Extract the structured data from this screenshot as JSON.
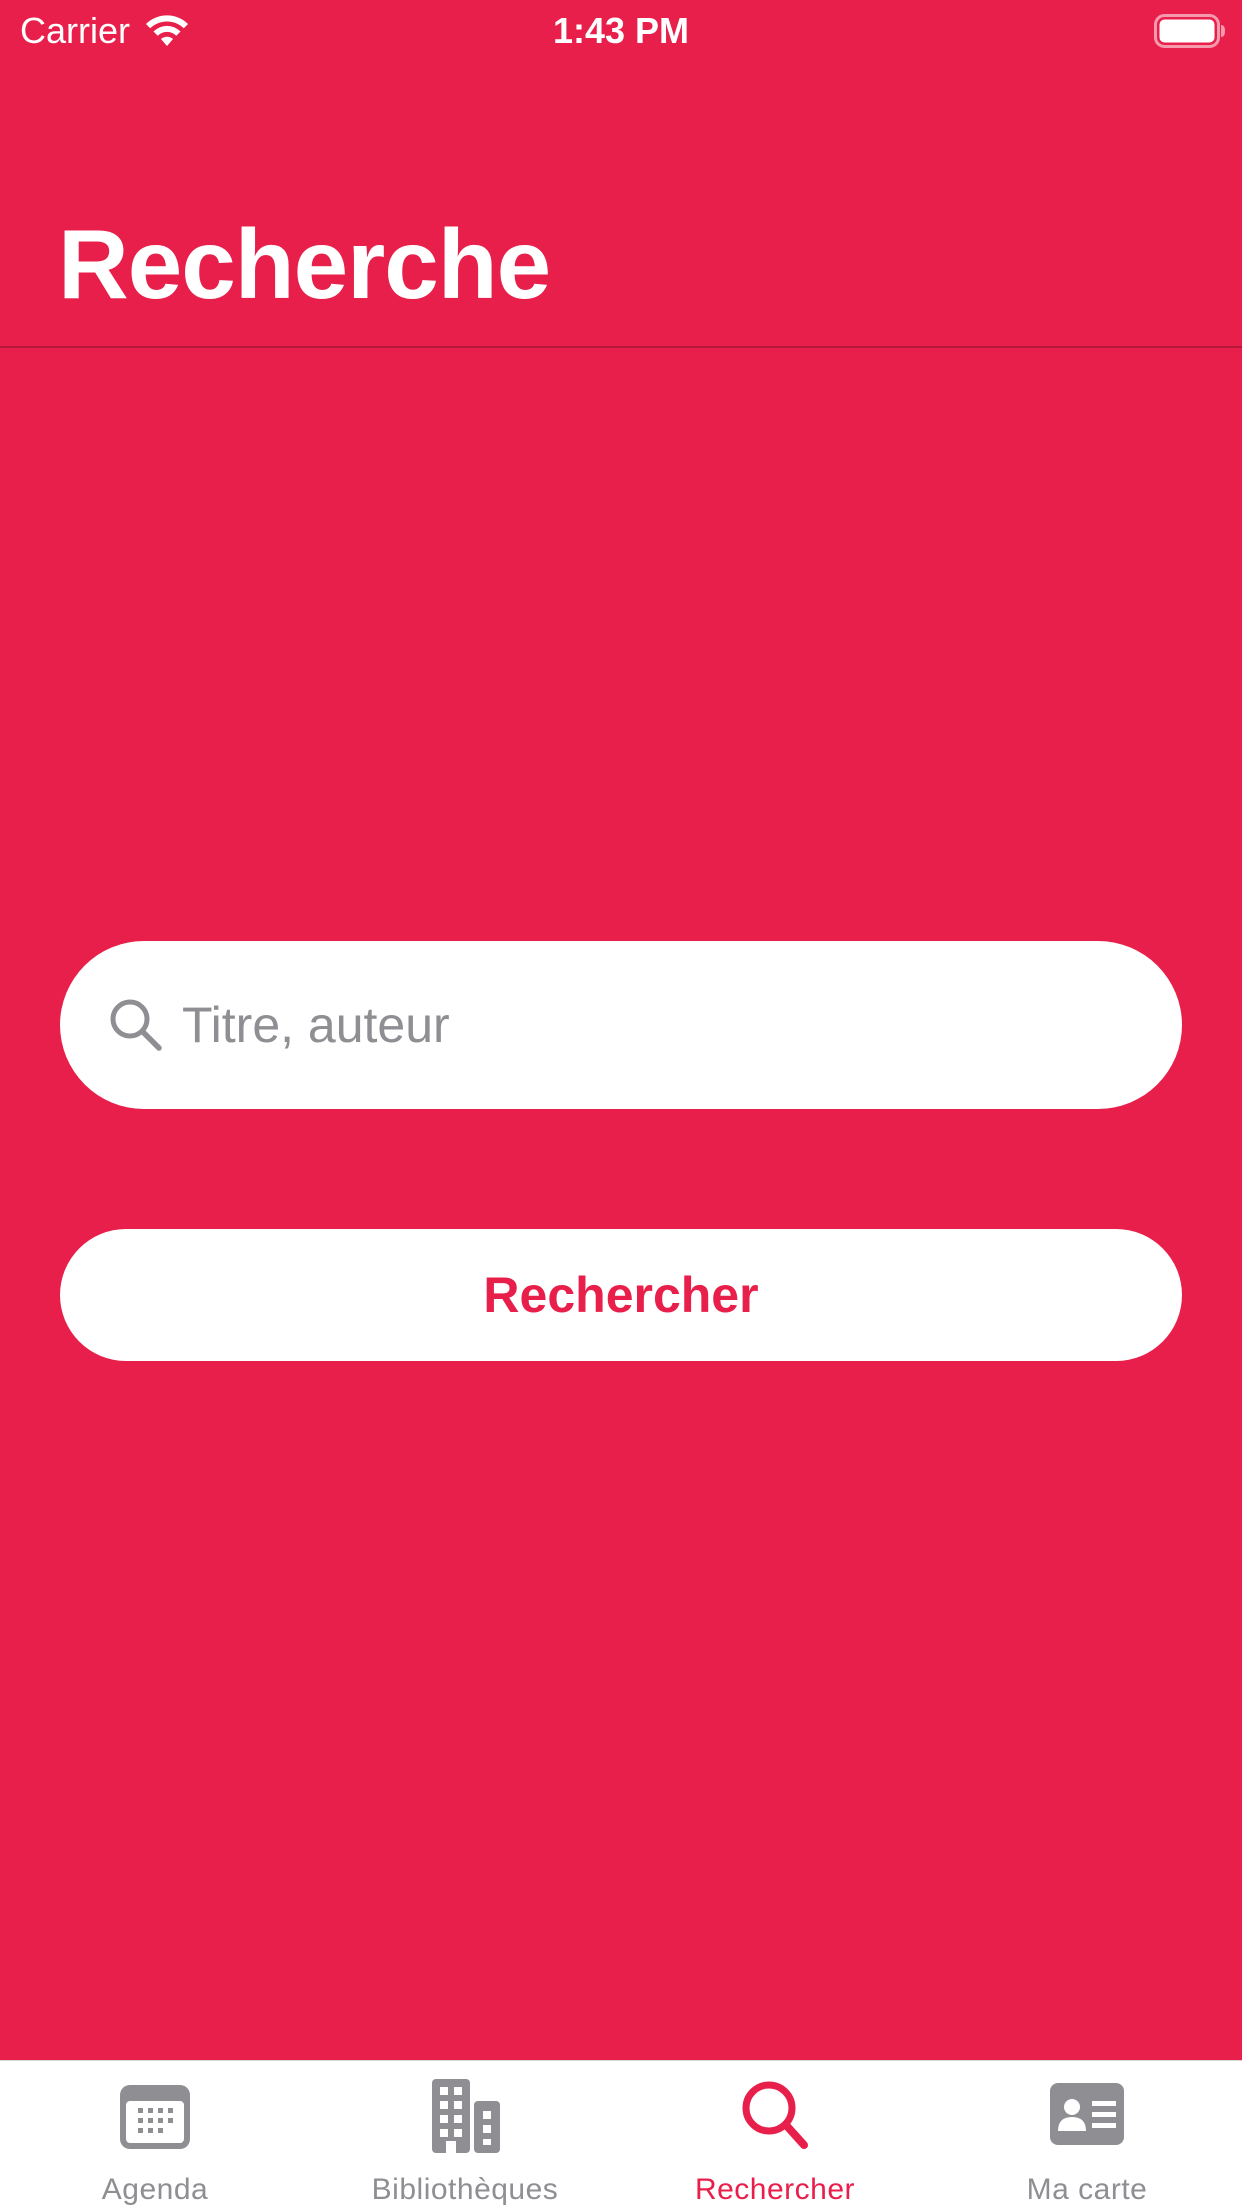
{
  "status_bar": {
    "carrier": "Carrier",
    "time": "1:43 PM"
  },
  "header": {
    "title": "Recherche"
  },
  "search": {
    "placeholder": "Titre, auteur",
    "value": "",
    "button_label": "Rechercher"
  },
  "tab_bar": {
    "tabs": [
      {
        "label": "Agenda",
        "icon": "calendar-icon",
        "active": false
      },
      {
        "label": "Bibliothèques",
        "icon": "building-icon",
        "active": false
      },
      {
        "label": "Rechercher",
        "icon": "search-icon",
        "active": true
      },
      {
        "label": "Ma carte",
        "icon": "id-card-icon",
        "active": false
      }
    ]
  },
  "colors": {
    "brand": "#E81F4A",
    "inactive_tab": "#8E8E93",
    "surface": "#FFFFFF"
  }
}
